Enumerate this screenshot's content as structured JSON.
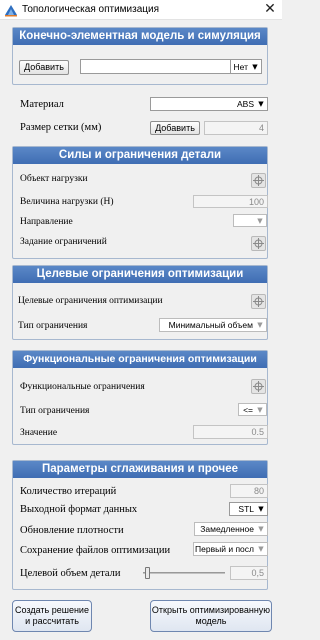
{
  "window": {
    "title": "Топологическая оптимизация",
    "close_glyph": "✕",
    "icon": "app-logo-icon"
  },
  "fem_section": {
    "header": "Конечно-элементная модель и симуляция",
    "add_button": "Добавить",
    "model_field_value": "",
    "dropdown_value": "Нет"
  },
  "material": {
    "label": "Материал",
    "value": "ABS"
  },
  "mesh": {
    "label": "Размер сетки (мм)",
    "add_button": "Добавить",
    "value": "4"
  },
  "forces_section": {
    "header": "Силы и ограничения детали",
    "load_object_label": "Объект нагрузки",
    "load_value_label": "Величина нагрузки (Н)",
    "load_value": "100",
    "direction_label": "Направление",
    "direction_value": "",
    "constraints_label": "Задание ограничений"
  },
  "target_section": {
    "header": "Целевые ограничения оптимизации",
    "constraints_label": "Целевые ограничения оптимизации",
    "type_label": "Тип ограничения",
    "type_value": "Минимальный объем"
  },
  "functional_section": {
    "header": "Функциональные ограничения оптимизации",
    "constraints_label": "Функциональные ограничения",
    "type_label": "Тип ограничения",
    "type_value": "<=",
    "value_label": "Значение",
    "value": "0.5"
  },
  "smoothing_section": {
    "header": "Параметры сглаживания и прочее",
    "iterations_label": "Количество итераций",
    "iterations_value": "80",
    "output_format_label": "Выходной формат данных",
    "output_format_value": "STL",
    "density_update_label": "Обновление плотности",
    "density_update_value": "Замедленное",
    "save_files_label": "Сохранение файлов оптимизации",
    "save_files_value": "Первый и посл",
    "target_volume_label": "Целевой объем детали",
    "target_volume_value": "0,5",
    "target_volume_slider_fraction": 0.02
  },
  "footer": {
    "create_button": "Создать решение\nи рассчитать",
    "open_button": "Открыть оптимизированную\nмодель"
  },
  "colors": {
    "panel_header": "#4a78bd",
    "panel_header_text": "#ffffff",
    "panel_border": "#a7b8cf",
    "window_bg": "#f0f0f0"
  }
}
